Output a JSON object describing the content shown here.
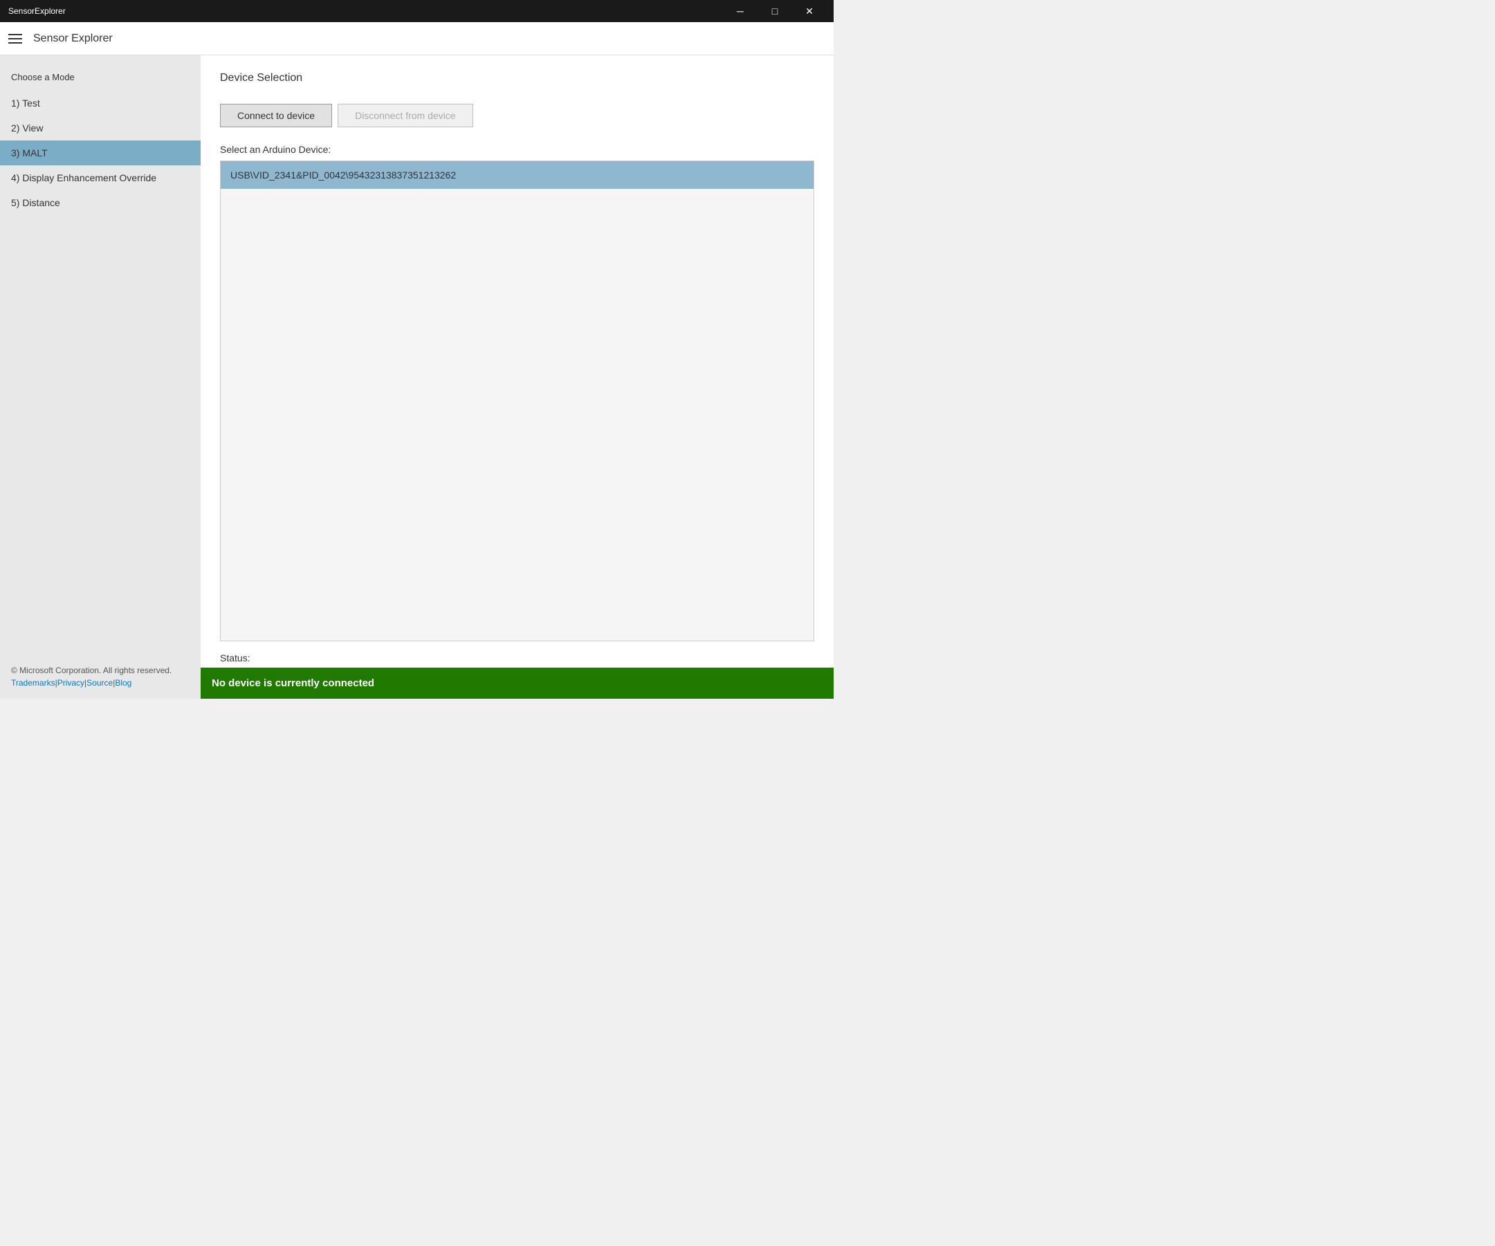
{
  "titlebar": {
    "title": "SensorExplorer",
    "minimize_label": "─",
    "maximize_label": "□",
    "close_label": "✕"
  },
  "header": {
    "title": "Sensor Explorer"
  },
  "sidebar": {
    "heading": "Choose a Mode",
    "items": [
      {
        "id": "test",
        "label": "1) Test"
      },
      {
        "id": "view",
        "label": "2) View"
      },
      {
        "id": "malt",
        "label": "3) MALT",
        "active": true
      },
      {
        "id": "display",
        "label": "4) Display Enhancement Override"
      },
      {
        "id": "distance",
        "label": "5) Distance"
      }
    ],
    "footer_text": "© Microsoft Corporation. All rights reserved.",
    "footer_links": [
      {
        "label": "Trademarks",
        "href": "#"
      },
      {
        "label": "Privacy",
        "href": "#"
      },
      {
        "label": "Source",
        "href": "#"
      },
      {
        "label": "Blog",
        "href": "#"
      }
    ]
  },
  "content": {
    "title": "Device Selection",
    "connect_label": "Connect to device",
    "disconnect_label": "Disconnect from device",
    "device_select_label": "Select an Arduino Device:",
    "devices": [
      "USB\\VID_2341&PID_0042\\95432313837351213262"
    ]
  },
  "status": {
    "label": "Status:",
    "message": "No device is currently connected"
  }
}
